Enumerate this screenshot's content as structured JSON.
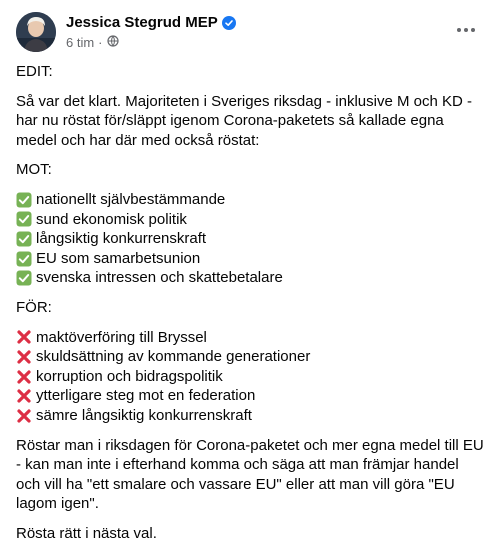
{
  "post": {
    "author": "Jessica Stegrud MEP",
    "time": "6 tim",
    "edit_label": "EDIT:",
    "intro": "Så var det klart. Majoriteten i Sveriges riksdag - inklusive M och KD - har nu röstat för/släppt igenom Corona-paketets så kallade egna medel och har där med också röstat:",
    "against_heading": "MOT:",
    "against_items": [
      "nationellt självbestämmande",
      "sund ekonomisk politik",
      "långsiktig konkurrenskraft",
      "EU som samarbetsunion",
      "svenska intressen och skattebetalare"
    ],
    "for_heading": "FÖR:",
    "for_items": [
      "maktöverföring till Bryssel",
      "skuldsättning av kommande generationer",
      "korruption och bidragspolitik",
      "ytterligare steg mot en federation",
      "sämre långsiktig konkurrenskraft"
    ],
    "closing": "Röstar man i riksdagen för Corona-paketet och mer egna medel till EU - kan man inte i efterhand komma och säga att man främjar handel och vill ha \"ett smalare och vassare EU\" eller att man vill göra \"EU lagom igen\".",
    "final": "Rösta rätt i nästa val."
  },
  "icons": {
    "check": "check-mark-button-icon",
    "cross": "cross-mark-icon",
    "privacy": "globe-icon",
    "more": "more-options-icon",
    "verified": "verified-badge-icon"
  },
  "colors": {
    "verified": "#1877f2",
    "check_green": "#77b255",
    "cross_red": "#dd2e44",
    "meta_gray": "#65676b"
  }
}
